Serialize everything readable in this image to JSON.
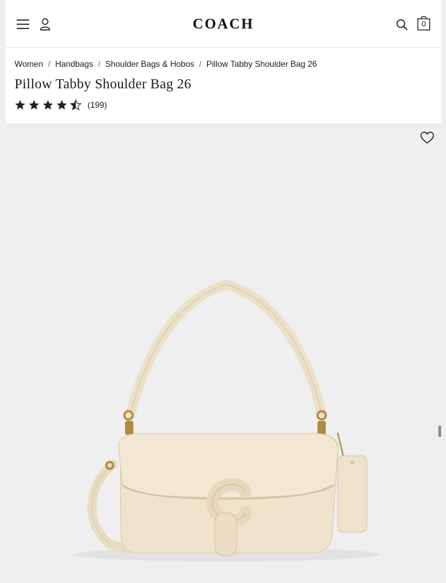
{
  "brand": {
    "logo_text": "COACH"
  },
  "header": {
    "bag_count": "0"
  },
  "breadcrumb": [
    {
      "label": "Women"
    },
    {
      "label": "Handbags"
    },
    {
      "label": "Shoulder Bags & Hobos"
    },
    {
      "label": "Pillow Tabby Shoulder Bag 26"
    }
  ],
  "product": {
    "title": "Pillow Tabby Shoulder Bag 26",
    "rating": 4.5,
    "rating_max": 5,
    "review_count": "(199)"
  },
  "icons": [
    "menu-icon",
    "user-icon",
    "search-icon",
    "shopping-bag-icon",
    "heart-icon",
    "star-icon"
  ],
  "colors": {
    "bag": "#efe3cd",
    "hardware": "#b08a3e",
    "text": "#1a1a1a"
  }
}
